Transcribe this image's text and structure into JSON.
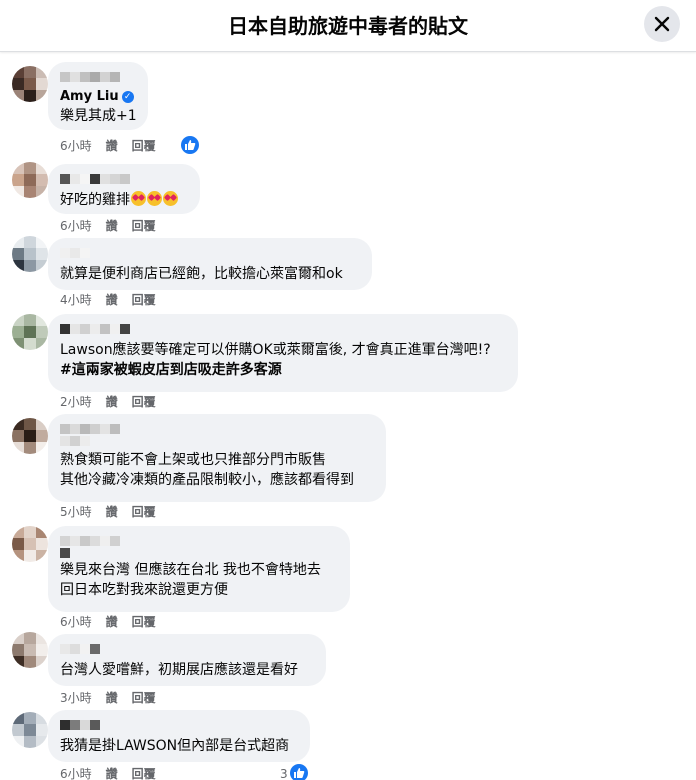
{
  "header": {
    "title": "日本自助旅遊中毒者的貼文"
  },
  "actions_labels": {
    "like": "讚",
    "reply": "回覆"
  },
  "comments": [
    {
      "author": "Amy Liu",
      "lines": [
        "樂見其成+1"
      ],
      "time": "6小時",
      "likes": ""
    },
    {
      "author": "",
      "lines": [
        "好吃的雞排"
      ],
      "time": "6小時",
      "likes": ""
    },
    {
      "author": "",
      "lines": [
        "就算是便利商店已經飽，比較擔心萊富爾和ok"
      ],
      "time": "4小時",
      "likes": ""
    },
    {
      "author": "",
      "lines": [
        "Lawson應該要等確定可以併購OK或萊爾富後, 才會真正進軍台灣吧!?",
        "#這兩家被蝦皮店到店吸走許多客源"
      ],
      "time": "2小時",
      "likes": ""
    },
    {
      "author": "",
      "lines": [
        "熟食類可能不會上架或也只推部分門市販售",
        "其他冷藏冷凍類的產品限制較小，應該都看得到"
      ],
      "time": "5小時",
      "likes": ""
    },
    {
      "author": "",
      "lines": [
        "樂見來台灣 但應該在台北 我也不會特地去",
        "回日本吃對我來說還更方便"
      ],
      "time": "6小時",
      "likes": ""
    },
    {
      "author": "",
      "lines": [
        "台灣人愛嚐鮮，初期展店應該還是看好"
      ],
      "time": "3小時",
      "likes": ""
    },
    {
      "author": "",
      "lines": [
        "我猜是掛LAWSON但內部是台式超商"
      ],
      "time": "6小時",
      "likes": "3"
    }
  ],
  "colors": {
    "accent": "#1877f2",
    "bubble": "#f0f2f5",
    "meta": "#65676b"
  },
  "icons": [
    "close-icon",
    "verified-badge-icon",
    "like-reaction-icon",
    "heart-eyes-emoji-icon"
  ]
}
